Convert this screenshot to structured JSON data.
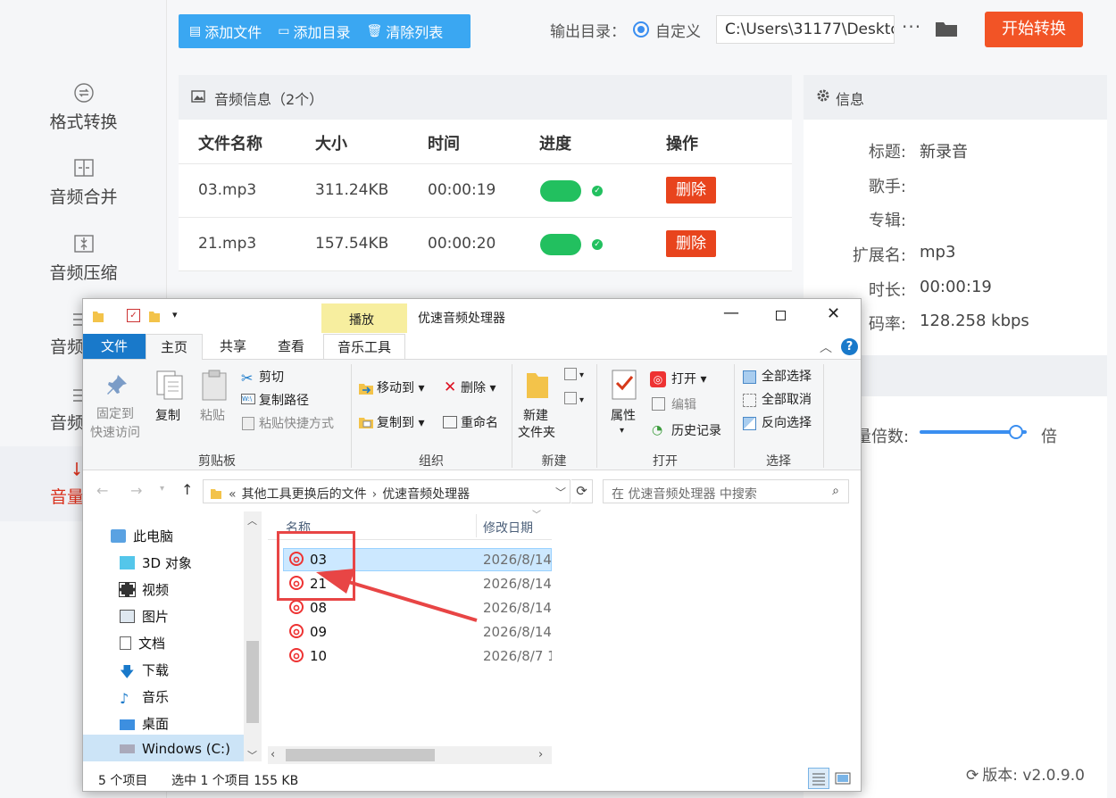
{
  "sidebar": {
    "items": [
      {
        "label": "格式转换",
        "icon": "convert-icon"
      },
      {
        "label": "音频合并",
        "icon": "merge-icon"
      },
      {
        "label": "音频压缩",
        "icon": "compress-icon"
      },
      {
        "label": "音频",
        "icon": "audio-icon"
      },
      {
        "label": "音频",
        "icon": "audio-icon"
      },
      {
        "label": "音量",
        "icon": "volume-icon"
      }
    ]
  },
  "toolbar": {
    "add_file": "添加文件",
    "add_dir": "添加目录",
    "clear_list": "清除列表",
    "output_label": "输出目录：",
    "custom_label": "自定义",
    "output_path": "C:\\Users\\31177\\Deskto",
    "more": "···",
    "start": "开始转换"
  },
  "audio": {
    "header": "音频信息（2个）",
    "columns": [
      "文件名称",
      "大小",
      "时间",
      "进度",
      "操作"
    ],
    "rows": [
      {
        "name": "03.mp3",
        "size": "311.24KB",
        "time": "00:00:19",
        "action": "删除"
      },
      {
        "name": "21.mp3",
        "size": "157.54KB",
        "time": "00:00:20",
        "action": "删除"
      }
    ]
  },
  "info": {
    "header": "信息",
    "fields": [
      {
        "label": "标题:",
        "value": "新录音"
      },
      {
        "label": "歌手:",
        "value": ""
      },
      {
        "label": "专辑:",
        "value": ""
      },
      {
        "label": "扩展名:",
        "value": "mp3"
      },
      {
        "label": "时长:",
        "value": "00:00:19"
      },
      {
        "label": "码率:",
        "value": "128.258 kbps"
      }
    ],
    "volume_label": "量倍数:",
    "volume_unit": "倍",
    "version": "版本:  v2.0.9.0"
  },
  "explorer": {
    "title": "优速音频处理器",
    "play_tab": "播放",
    "tabs": {
      "file": "文件",
      "home": "主页",
      "share": "共享",
      "view": "查看",
      "music": "音乐工具"
    },
    "clipboard": {
      "pin": "固定到",
      "pin2": "快速访问",
      "copy": "复制",
      "paste": "粘贴",
      "cut": "剪切",
      "copy_path": "复制路径",
      "paste_shortcut": "粘贴快捷方式",
      "group": "剪贴板"
    },
    "organize": {
      "move_to": "移动到",
      "delete": "删除",
      "copy_to": "复制到",
      "rename": "重命名",
      "group": "组织"
    },
    "new": {
      "new_folder": "新建",
      "new_folder2": "文件夹",
      "group": "新建"
    },
    "open": {
      "properties": "属性",
      "open": "打开",
      "edit": "编辑",
      "history": "历史记录",
      "group": "打开"
    },
    "select": {
      "all": "全部选择",
      "none": "全部取消",
      "invert": "反向选择",
      "group": "选择"
    },
    "address": {
      "prefix": "«",
      "part1": "其他工具更换后的文件",
      "sep": "›",
      "part2": "优速音频处理器"
    },
    "search_placeholder": "在 优速音频处理器 中搜索",
    "nav": [
      {
        "label": "此电脑",
        "icon": "pc-icon"
      },
      {
        "label": "3D 对象",
        "icon": "3d-objects-icon"
      },
      {
        "label": "视频",
        "icon": "video-icon"
      },
      {
        "label": "图片",
        "icon": "pictures-icon"
      },
      {
        "label": "文档",
        "icon": "documents-icon"
      },
      {
        "label": "下载",
        "icon": "downloads-icon"
      },
      {
        "label": "音乐",
        "icon": "music-icon"
      },
      {
        "label": "桌面",
        "icon": "desktop-icon"
      },
      {
        "label": "Windows (C:)",
        "icon": "drive-icon"
      }
    ],
    "col_name": "名称",
    "col_date": "修改日期",
    "files": [
      {
        "name": "03",
        "date": "2026/8/14"
      },
      {
        "name": "21",
        "date": "2026/8/14"
      },
      {
        "name": "08",
        "date": "2026/8/14"
      },
      {
        "name": "09",
        "date": "2026/8/14"
      },
      {
        "name": "10",
        "date": "2026/8/7 1"
      }
    ],
    "status_count": "5 个项目",
    "status_selected": "选中 1 个项目  155 KB"
  }
}
